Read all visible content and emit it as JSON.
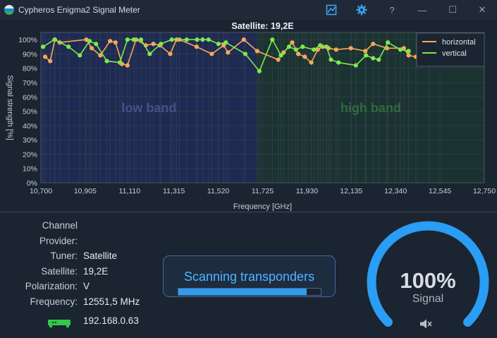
{
  "window": {
    "title": "Cypheros Enigma2 Signal Meter",
    "help_label": "?",
    "min_label": "—",
    "max_label": "☐",
    "close_label": "✕"
  },
  "chart_data": {
    "type": "line",
    "title": "Satellite: 19,2E",
    "xlabel": "Frequency [GHz]",
    "ylabel": "Signal strength [%]",
    "xlim": [
      10700,
      12750
    ],
    "ylim": [
      0,
      105
    ],
    "x_ticks": [
      "10,700",
      "10,905",
      "11,110",
      "11,315",
      "11,520",
      "11,725",
      "11,930",
      "12,135",
      "12,340",
      "12,545",
      "12,750"
    ],
    "y_ticks": [
      "0%",
      "10%",
      "20%",
      "30%",
      "40%",
      "50%",
      "60%",
      "70%",
      "80%",
      "90%",
      "100%"
    ],
    "regions": [
      {
        "label": "low band",
        "from": 10700,
        "to": 11700,
        "color": "#1e2a52"
      },
      {
        "label": "high band",
        "from": 11700,
        "to": 12750,
        "color": "#1b3330"
      }
    ],
    "legend_position": "top-right",
    "series": [
      {
        "name": "horizontal",
        "color": "#f5a85a",
        "x": [
          10720,
          10743,
          10765,
          10787,
          10910,
          10935,
          10975,
          11020,
          11045,
          11075,
          11100,
          11140,
          11185,
          11220,
          11250,
          11298,
          11327,
          11340,
          11420,
          11490,
          11545,
          11565,
          11638,
          11700,
          11797,
          11822,
          11862,
          11890,
          11920,
          11950,
          11980,
          12003,
          12030,
          12065,
          12133,
          12200,
          12236,
          12300,
          12378,
          12400,
          12434,
          12496
        ],
        "y": [
          88,
          85,
          100,
          98,
          100,
          94,
          89,
          99,
          98,
          83,
          82,
          100,
          96,
          97,
          96,
          90,
          100,
          100,
          95,
          90,
          96,
          91,
          100,
          92,
          86,
          91,
          98,
          90,
          88,
          84,
          93,
          95,
          94,
          93,
          94,
          92,
          97,
          94,
          94,
          89,
          88,
          88
        ]
      },
      {
        "name": "vertical",
        "color": "#7ee84f",
        "x": [
          10710,
          10763,
          10828,
          10880,
          10925,
          10955,
          11005,
          11065,
          11100,
          11129,
          11163,
          11203,
          11255,
          11305,
          11374,
          11422,
          11448,
          11475,
          11521,
          11555,
          11645,
          11710,
          11770,
          11810,
          11847,
          11879,
          11910,
          11962,
          11991,
          12020,
          12041,
          12076,
          12156,
          12203,
          12236,
          12262,
          12304,
          12362,
          12400
        ],
        "y": [
          95,
          100,
          95,
          89,
          99,
          97,
          85,
          84,
          100,
          100,
          100,
          90,
          97,
          100,
          100,
          100,
          100,
          100,
          97,
          98,
          90,
          78,
          100,
          89,
          95,
          93,
          95,
          93,
          96,
          95,
          86,
          84,
          82,
          89,
          87,
          86,
          98,
          93,
          92
        ]
      }
    ]
  },
  "info": {
    "fields": [
      {
        "label": "Channel",
        "value": ""
      },
      {
        "label": "Provider:",
        "value": ""
      },
      {
        "label": "Tuner:",
        "value": "Satellite"
      },
      {
        "label": "Satellite:",
        "value": "19,2E"
      },
      {
        "label": "Polarization:",
        "value": "V"
      },
      {
        "label": "Frequency:",
        "value": "12551,5 MHz"
      }
    ],
    "ip": "192.168.0.63",
    "network_icon": "network-device-icon",
    "network_icon_color": "#31c94a"
  },
  "scan": {
    "title": "Scanning transponders",
    "progress": 0.9
  },
  "gauge": {
    "value_text": "100%",
    "label": "Signal",
    "level": 1.0,
    "color": "#2a9df4",
    "mute_icon": "speaker-muted-icon"
  }
}
